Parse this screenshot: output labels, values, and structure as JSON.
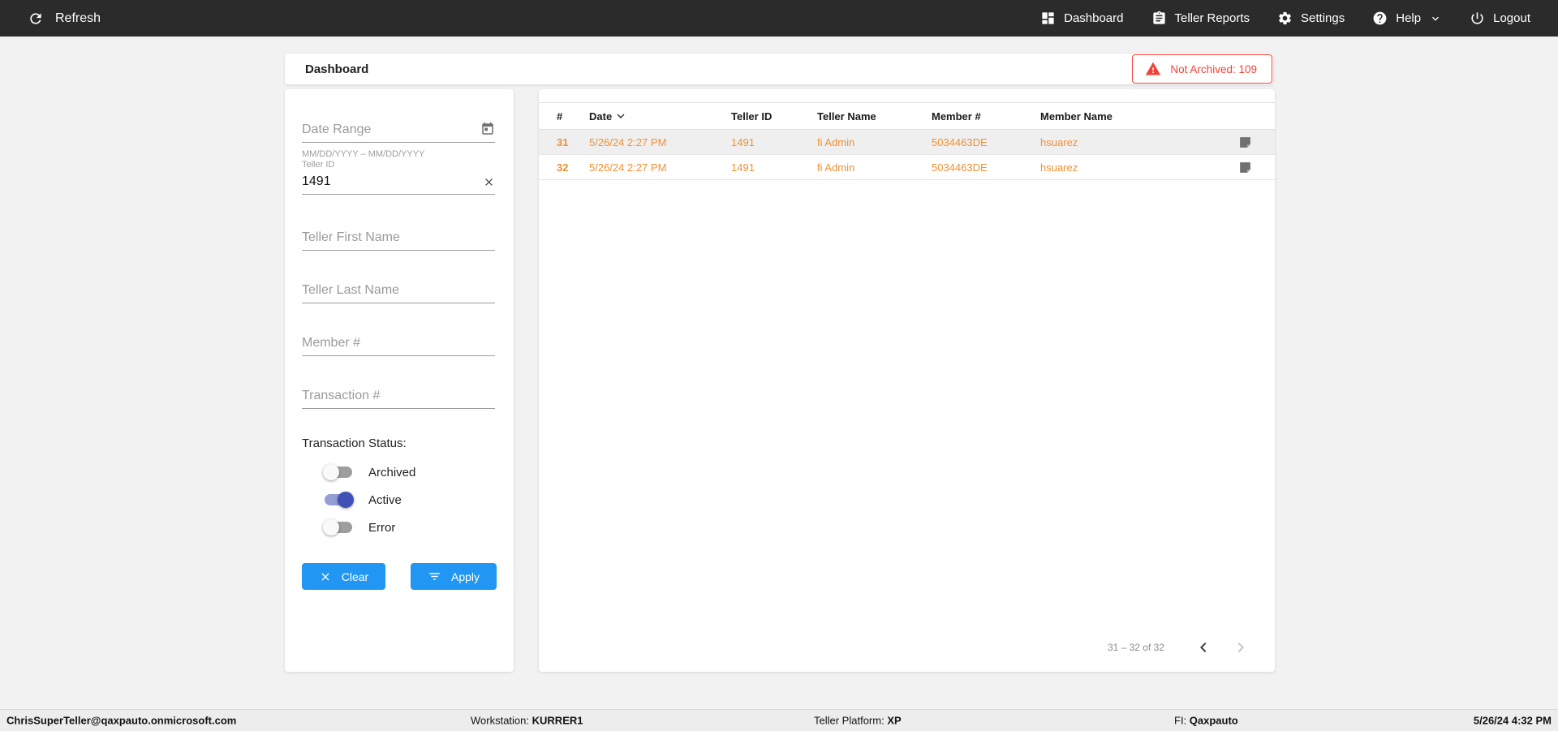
{
  "navbar": {
    "refresh_label": "Refresh",
    "items": [
      {
        "label": "Dashboard",
        "icon": "dashboard-icon"
      },
      {
        "label": "Teller Reports",
        "icon": "clipboard-icon"
      },
      {
        "label": "Settings",
        "icon": "gear-icon"
      },
      {
        "label": "Help",
        "icon": "help-icon"
      },
      {
        "label": "Logout",
        "icon": "power-icon"
      }
    ]
  },
  "page": {
    "title": "Dashboard",
    "badge_label": "Not Archived: 109"
  },
  "filters": {
    "date_range": {
      "placeholder": "Date Range",
      "hint": "MM/DD/YYYY – MM/DD/YYYY"
    },
    "teller_id": {
      "label": "Teller ID",
      "value": "1491"
    },
    "teller_first_name": {
      "placeholder": "Teller First Name"
    },
    "teller_last_name": {
      "placeholder": "Teller Last Name"
    },
    "member_number": {
      "placeholder": "Member #"
    },
    "transaction_number": {
      "placeholder": "Transaction #"
    },
    "status": {
      "label": "Transaction Status:",
      "toggles": [
        {
          "label": "Archived",
          "on": false
        },
        {
          "label": "Active",
          "on": true
        },
        {
          "label": "Error",
          "on": false
        }
      ]
    },
    "clear_label": "Clear",
    "apply_label": "Apply"
  },
  "table": {
    "columns": [
      "#",
      "Date",
      "Teller ID",
      "Teller Name",
      "Member #",
      "Member Name"
    ],
    "rows": [
      {
        "num": "31",
        "date": "5/26/24 2:27 PM",
        "teller_id": "1491",
        "teller_name": "fi Admin",
        "member_number": "5034463DE",
        "member_name": "hsuarez"
      },
      {
        "num": "32",
        "date": "5/26/24 2:27 PM",
        "teller_id": "1491",
        "teller_name": "fi Admin",
        "member_number": "5034463DE",
        "member_name": "hsuarez"
      }
    ],
    "pagination": {
      "range_label": "31 – 32 of 32"
    }
  },
  "footer": {
    "user": "ChrisSuperTeller@qaxpauto.onmicrosoft.com",
    "workstation_label": "Workstation:",
    "workstation_value": "KURRER1",
    "platform_label": "Teller Platform:",
    "platform_value": "XP",
    "fi_label": "FI:",
    "fi_value": "Qaxpauto",
    "datetime": "5/26/24 4:32 PM"
  },
  "colors": {
    "navbar_bg": "#2b2b2b",
    "accent_blue": "#2196f3",
    "row_orange": "#f09133",
    "alert_red": "#f44336",
    "toggle_indigo": "#3f51b5"
  }
}
